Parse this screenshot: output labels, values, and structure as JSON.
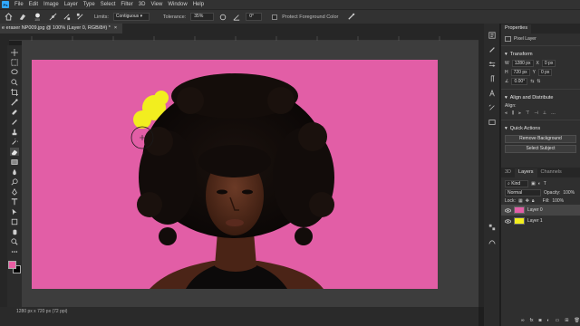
{
  "menubar": {
    "items": [
      "File",
      "Edit",
      "Image",
      "Layer",
      "Type",
      "Select",
      "Filter",
      "3D",
      "View",
      "Window",
      "Help"
    ]
  },
  "options": {
    "brush_size": "100",
    "limits_label": "Limits:",
    "limits_value": "Contiguous",
    "tolerance_label": "Tolerance:",
    "tolerance_value": "35%",
    "angle_value": "0°",
    "protect_label": "Protect Foreground Color"
  },
  "document": {
    "tab_title": "e eraser NP009.jpg @ 100% (Layer 0, RGB/8#) *",
    "close_label": "×",
    "status": "1280 px x 720 px (72 ppi)"
  },
  "colors": {
    "foreground": "#e95ea4",
    "background": "#000000",
    "canvas_bg": "#e25ea6",
    "accent": "#31a8ff",
    "yellow_paint": "#f2ee1f"
  },
  "properties": {
    "tab": "Properties",
    "type_label": "Pixel Layer",
    "transform_title": "Transform",
    "w_label": "W",
    "w_value": "1280 px",
    "h_label": "H",
    "h_value": "720 px",
    "x_label": "X",
    "x_value": "0 px",
    "y_label": "Y",
    "y_value": "0 px",
    "angle_value": "0.00°",
    "align_title": "Align and Distribute",
    "align_label": "Align:",
    "quick_actions_title": "Quick Actions",
    "remove_bg": "Remove Background",
    "select_subject": "Select Subject"
  },
  "layers": {
    "tabs": [
      "3D",
      "Layers",
      "Channels"
    ],
    "kind_label": "Kind",
    "blend_mode": "Normal",
    "opacity_label": "Opacity:",
    "opacity_value": "100%",
    "lock_label": "Lock:",
    "fill_label": "Fill:",
    "fill_value": "100%",
    "items": [
      {
        "name": "Layer 0",
        "selected": true
      },
      {
        "name": "Layer 1",
        "selected": false
      }
    ]
  },
  "icons": {
    "toolbar": [
      "move-tool-icon",
      "artboard-tool-icon",
      "marquee-tool-icon",
      "lasso-tool-icon",
      "quick-select-tool-icon",
      "crop-tool-icon",
      "eyedropper-tool-icon",
      "healing-tool-icon",
      "brush-tool-icon",
      "stamp-tool-icon",
      "history-brush-icon",
      "eraser-tool-icon",
      "gradient-tool-icon",
      "blur-tool-icon",
      "dodge-tool-icon",
      "pen-tool-icon",
      "type-tool-icon",
      "path-select-tool-icon",
      "shape-tool-icon",
      "hand-tool-icon",
      "zoom-tool-icon",
      "more-tools-icon"
    ]
  }
}
